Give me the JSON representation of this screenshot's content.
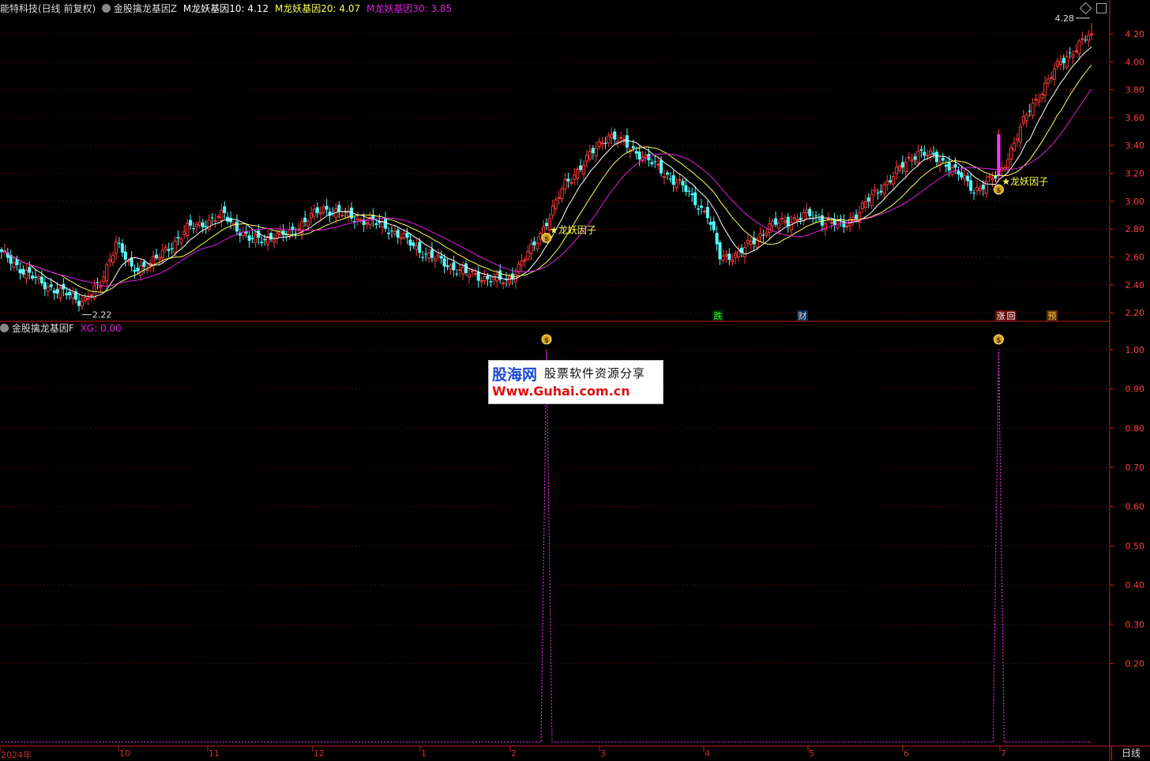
{
  "header": {
    "top_title": "能特科技(日线 前复权)",
    "top_indicator_name": "金股擒龙基因Z",
    "ma10_label": "M龙妖基因10: 4.12",
    "ma20_label": "M龙妖基因20: 4.07",
    "ma30_label": "M龙妖基因30: 3.85",
    "bottom_indicator_name": "金股擒龙基因F",
    "xg_label": "XG: 0.00"
  },
  "annotations": {
    "max_price": "4.28",
    "min_price": "2.22",
    "signal_label": "★龙妖因子",
    "event_die": "跌",
    "event_cai": "财",
    "event_zhang": "涨",
    "event_hui": "回",
    "event_yu": "预",
    "money_icon": "money-bag-icon"
  },
  "watermark": {
    "line1_a": "股海网",
    "line1_b": "股票软件资源分享",
    "line2": "Www.Guhai.com.cn"
  },
  "x_axis_labels": [
    "2024年",
    "10",
    "11",
    "12",
    "1",
    "2",
    "3",
    "4",
    "5",
    "6",
    "7"
  ],
  "period": "日线",
  "colors": {
    "up": "#ff3a3a",
    "down": "#54ffff",
    "ma10": "#ffffff",
    "ma20": "#ffff55",
    "ma30": "#e020e0",
    "signal": "#ff3aff",
    "grid": "#8a1010",
    "axis_text": "#ff4040",
    "frame": "#c81e1e"
  },
  "chart_data": [
    {
      "type": "candlestick",
      "title": "金股擒龙基因Z",
      "ylim": [
        2.15,
        4.33
      ],
      "y_ticks": [
        "4.20",
        "4.00",
        "3.80",
        "3.60",
        "3.40",
        "3.20",
        "3.00",
        "2.80",
        "2.60",
        "2.40",
        "2.20"
      ],
      "series_names": [
        "M龙妖基因10",
        "M龙妖基因20",
        "M龙妖基因30"
      ],
      "close_waypoints": [
        [
          0,
          2.62
        ],
        [
          12,
          2.42
        ],
        [
          26,
          2.28
        ],
        [
          32,
          2.4
        ],
        [
          37,
          2.72
        ],
        [
          42,
          2.5
        ],
        [
          50,
          2.58
        ],
        [
          60,
          2.8
        ],
        [
          72,
          2.9
        ],
        [
          80,
          2.72
        ],
        [
          92,
          2.76
        ],
        [
          104,
          2.95
        ],
        [
          114,
          2.88
        ],
        [
          124,
          2.82
        ],
        [
          137,
          2.62
        ],
        [
          150,
          2.48
        ],
        [
          163,
          2.42
        ],
        [
          172,
          2.68
        ],
        [
          182,
          3.12
        ],
        [
          196,
          3.48
        ],
        [
          206,
          3.34
        ],
        [
          220,
          3.1
        ],
        [
          228,
          2.9
        ],
        [
          232,
          2.6
        ],
        [
          238,
          2.62
        ],
        [
          248,
          2.82
        ],
        [
          260,
          2.9
        ],
        [
          272,
          2.82
        ],
        [
          285,
          3.12
        ],
        [
          296,
          3.36
        ],
        [
          306,
          3.26
        ],
        [
          314,
          3.08
        ],
        [
          322,
          3.18
        ],
        [
          332,
          3.66
        ],
        [
          342,
          4.0
        ],
        [
          348,
          4.12
        ],
        [
          352,
          4.2
        ]
      ]
    },
    {
      "type": "line",
      "title": "金股擒龙基因F",
      "series_names": [
        "XG"
      ],
      "ylim": [
        0,
        1.04
      ],
      "y_ticks": [
        "1.00",
        "0.90",
        "0.80",
        "0.70",
        "0.60",
        "0.50",
        "0.40",
        "0.30",
        "0.20"
      ],
      "signal_bars": [
        176,
        322
      ]
    }
  ]
}
